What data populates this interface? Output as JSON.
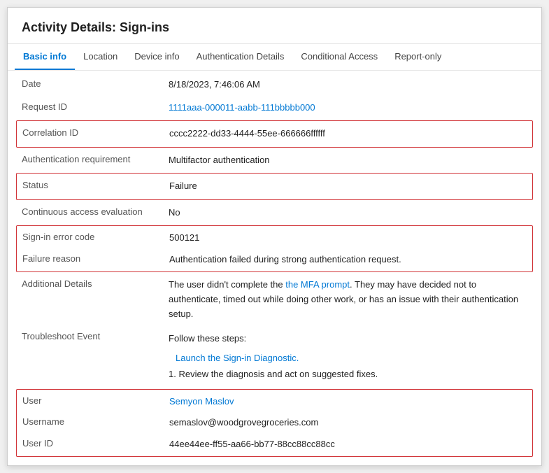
{
  "title": "Activity Details: Sign-ins",
  "tabs": [
    {
      "label": "Basic info",
      "active": true
    },
    {
      "label": "Location",
      "active": false
    },
    {
      "label": "Device info",
      "active": false
    },
    {
      "label": "Authentication Details",
      "active": false
    },
    {
      "label": "Conditional Access",
      "active": false
    },
    {
      "label": "Report-only",
      "active": false
    }
  ],
  "fields": {
    "date_label": "Date",
    "date_value": "8/18/2023, 7:46:06 AM",
    "request_id_label": "Request ID",
    "request_id_value": "1111aaa-000011-aabb-111bbbbb000",
    "correlation_id_label": "Correlation ID",
    "correlation_id_value": "cccc2222-dd33-4444-55ee-666666ffffff",
    "auth_req_label": "Authentication requirement",
    "auth_req_value": "Multifactor authentication",
    "status_label": "Status",
    "status_value": "Failure",
    "cae_label": "Continuous access evaluation",
    "cae_value": "No",
    "sign_in_error_label": "Sign-in error code",
    "sign_in_error_value": "500121",
    "failure_reason_label": "Failure reason",
    "failure_reason_value": "Authentication failed during strong authentication request.",
    "additional_details_label": "Additional Details",
    "additional_details_value": "The user didn't complete the MFA prompt. They may have decided not to authenticate, timed out while doing other work, or has an issue with their authentication setup.",
    "troubleshoot_label": "Troubleshoot Event",
    "troubleshoot_steps_header": "Follow these steps:",
    "troubleshoot_link": "Launch the Sign-in Diagnostic.",
    "troubleshoot_step1": "1. Review the diagnosis and act on suggested fixes.",
    "user_label": "User",
    "user_value": "Semyon Maslov",
    "username_label": "Username",
    "username_value": "semaslov@woodgrovegroceries.com",
    "user_id_label": "User ID",
    "user_id_value": "44ee44ee-ff55-aa66-bb77-88cc88cc88cc"
  }
}
